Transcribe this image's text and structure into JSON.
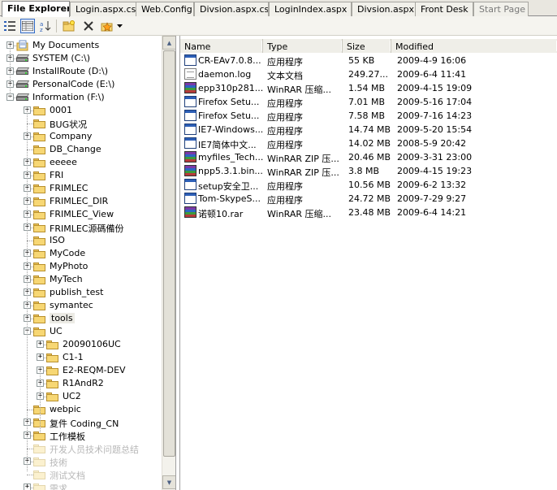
{
  "tabs": [
    {
      "label": "File Explorer",
      "active": true
    },
    {
      "label": "Login.aspx.cs"
    },
    {
      "label": "Web.Config"
    },
    {
      "label": "Divsion.aspx.cs"
    },
    {
      "label": "LoginIndex.aspx"
    },
    {
      "label": "Divsion.aspx"
    },
    {
      "label": "Front Desk"
    },
    {
      "label": "Start Page",
      "dim": true
    }
  ],
  "toolbar": {
    "icons": [
      "list-view-icon",
      "details-view-icon",
      "sort-icon",
      "new-folder-icon",
      "delete-icon",
      "favorites-icon",
      "dropdown-arrow-icon"
    ]
  },
  "tree": {
    "items": [
      {
        "label": "My Documents",
        "icon": "my-documents-icon",
        "level": 0,
        "expander": "+"
      },
      {
        "label": "SYSTEM (C:\\)",
        "icon": "drive-icon",
        "level": 0,
        "expander": "+"
      },
      {
        "label": "InstallRoute (D:\\)",
        "icon": "drive-icon",
        "level": 0,
        "expander": "+"
      },
      {
        "label": "PersonalCode (E:\\)",
        "icon": "drive-icon",
        "level": 0,
        "expander": "+"
      },
      {
        "label": "Information (F:\\)",
        "icon": "drive-icon",
        "level": 0,
        "expander": "-"
      },
      {
        "label": "0001",
        "icon": "folder-icon",
        "level": 1,
        "expander": "+"
      },
      {
        "label": "BUG状况",
        "icon": "folder-icon",
        "level": 1,
        "expander": ""
      },
      {
        "label": "Company",
        "icon": "folder-icon",
        "level": 1,
        "expander": "+"
      },
      {
        "label": "DB_Change",
        "icon": "folder-icon",
        "level": 1,
        "expander": ""
      },
      {
        "label": "eeeee",
        "icon": "folder-icon",
        "level": 1,
        "expander": "+"
      },
      {
        "label": "FRI",
        "icon": "folder-icon",
        "level": 1,
        "expander": "+"
      },
      {
        "label": "FRIMLEC",
        "icon": "folder-icon",
        "level": 1,
        "expander": "+"
      },
      {
        "label": "FRIMLEC_DIR",
        "icon": "folder-icon",
        "level": 1,
        "expander": "+"
      },
      {
        "label": "FRIMLEC_View",
        "icon": "folder-icon",
        "level": 1,
        "expander": "+"
      },
      {
        "label": "FRIMLEC源碼備份",
        "icon": "folder-icon",
        "level": 1,
        "expander": "+"
      },
      {
        "label": "ISO",
        "icon": "folder-icon",
        "level": 1,
        "expander": ""
      },
      {
        "label": "MyCode",
        "icon": "folder-icon",
        "level": 1,
        "expander": "+"
      },
      {
        "label": "MyPhoto",
        "icon": "folder-icon",
        "level": 1,
        "expander": "+"
      },
      {
        "label": "MyTech",
        "icon": "folder-icon",
        "level": 1,
        "expander": "+"
      },
      {
        "label": "publish_test",
        "icon": "folder-icon",
        "level": 1,
        "expander": "+"
      },
      {
        "label": "symantec",
        "icon": "folder-icon",
        "level": 1,
        "expander": "+"
      },
      {
        "label": "tools",
        "icon": "folder-icon",
        "level": 1,
        "expander": "+",
        "selected": true
      },
      {
        "label": "UC",
        "icon": "folder-icon",
        "level": 1,
        "expander": "-"
      },
      {
        "label": "20090106UC",
        "icon": "folder-icon",
        "level": 2,
        "expander": "+"
      },
      {
        "label": "C1-1",
        "icon": "folder-icon",
        "level": 2,
        "expander": "+"
      },
      {
        "label": "E2-REQM-DEV",
        "icon": "folder-icon",
        "level": 2,
        "expander": "+"
      },
      {
        "label": "R1AndR2",
        "icon": "folder-icon",
        "level": 2,
        "expander": "+"
      },
      {
        "label": "UC2",
        "icon": "folder-icon",
        "level": 2,
        "expander": "+"
      },
      {
        "label": "webpic",
        "icon": "folder-icon",
        "level": 1,
        "expander": ""
      },
      {
        "label": "复件 Coding_CN",
        "icon": "folder-icon",
        "level": 1,
        "expander": "+"
      },
      {
        "label": "工作模板",
        "icon": "folder-icon",
        "level": 1,
        "expander": "+"
      },
      {
        "label": "开发人员技术问题总结",
        "icon": "folder-icon",
        "level": 1,
        "expander": "",
        "faded": true
      },
      {
        "label": "技術",
        "icon": "folder-icon",
        "level": 1,
        "expander": "+",
        "faded": true
      },
      {
        "label": "测试文档",
        "icon": "folder-icon",
        "level": 1,
        "expander": "",
        "faded": true
      },
      {
        "label": "需求",
        "icon": "folder-icon",
        "level": 1,
        "expander": "+",
        "faded": true
      }
    ]
  },
  "list": {
    "columns": [
      "Name",
      "Type",
      "Size",
      "Modified"
    ],
    "rows": [
      {
        "icon": "exe",
        "name": "CR-EAv7.0.8...",
        "type": "应用程序",
        "size": "55 KB",
        "modified": "2009-4-9 16:06"
      },
      {
        "icon": "txt",
        "name": "daemon.log",
        "type": "文本文档",
        "size": "249.27...",
        "modified": "2009-6-4 11:41"
      },
      {
        "icon": "rar",
        "name": "epp310p281...",
        "type": "WinRAR 压缩...",
        "size": "1.54 MB",
        "modified": "2009-4-15 19:09"
      },
      {
        "icon": "exe",
        "name": "Firefox Setu...",
        "type": "应用程序",
        "size": "7.01 MB",
        "modified": "2009-5-16 17:04"
      },
      {
        "icon": "exe",
        "name": "Firefox Setu...",
        "type": "应用程序",
        "size": "7.58 MB",
        "modified": "2009-7-16 14:23"
      },
      {
        "icon": "exe",
        "name": "IE7-Windows...",
        "type": "应用程序",
        "size": "14.74 MB",
        "modified": "2009-5-20 15:54"
      },
      {
        "icon": "exe",
        "name": "IE7简体中文...",
        "type": "应用程序",
        "size": "14.02 MB",
        "modified": "2008-5-9 20:42"
      },
      {
        "icon": "rar",
        "name": "myfiles_Tech...",
        "type": "WinRAR ZIP 压...",
        "size": "20.46 MB",
        "modified": "2009-3-31 23:00"
      },
      {
        "icon": "rar",
        "name": "npp5.3.1.bin...",
        "type": "WinRAR ZIP 压...",
        "size": "3.8 MB",
        "modified": "2009-4-15 19:23"
      },
      {
        "icon": "exe",
        "name": "setup安全卫...",
        "type": "应用程序",
        "size": "10.56 MB",
        "modified": "2009-6-2 13:32"
      },
      {
        "icon": "exe",
        "name": "Tom-SkypeS...",
        "type": "应用程序",
        "size": "24.72 MB",
        "modified": "2009-7-29 9:27"
      },
      {
        "icon": "rar",
        "name": "诺顿10.rar",
        "type": "WinRAR 压缩...",
        "size": "23.48 MB",
        "modified": "2009-6-4 14:21"
      }
    ]
  },
  "colors": {
    "selection": "#316ac5",
    "folder": "#f7d774",
    "tab_strip": "#e9e7e0"
  }
}
